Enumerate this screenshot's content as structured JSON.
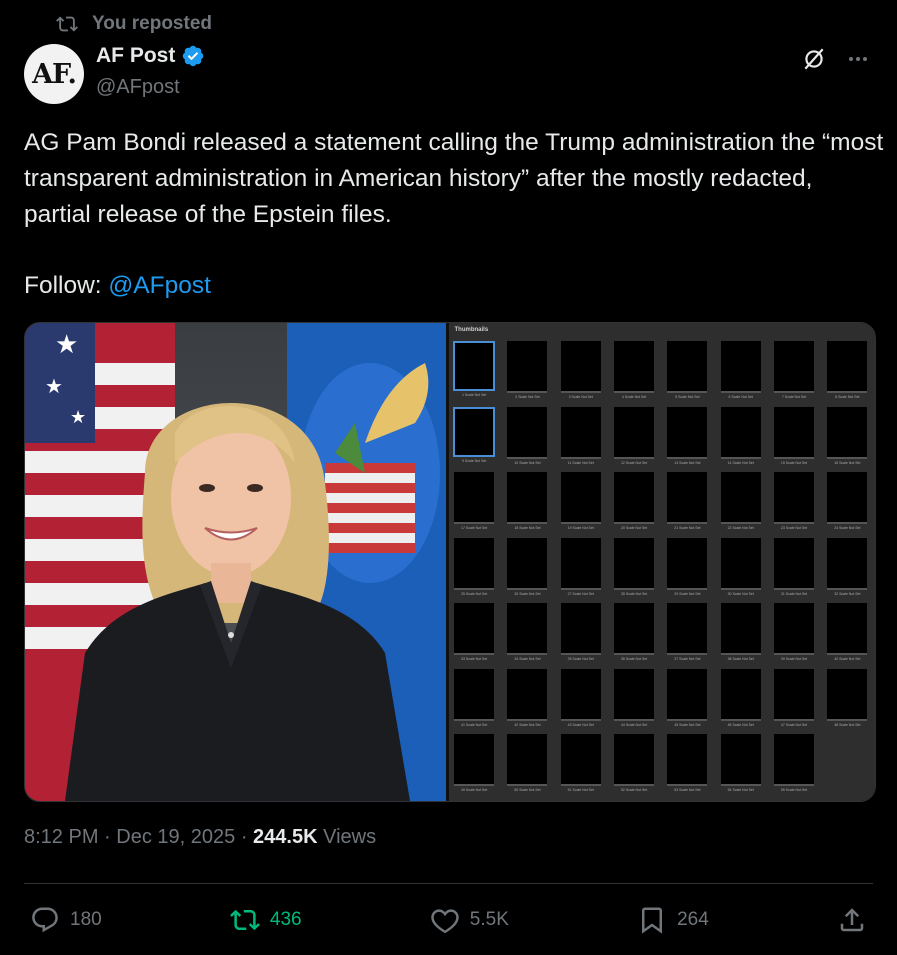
{
  "repost_notice": "You reposted",
  "author": {
    "avatar_text": "AF.",
    "name": "AF Post",
    "handle": "@AFpost",
    "verified": true
  },
  "tweet": {
    "text": "AG Pam Bondi released a statement calling the Trump administration the “most transparent administration in American history” after the mostly redacted, partial release of the Epstein files.",
    "follow_label": "Follow:",
    "follow_link": "@AFpost"
  },
  "media": {
    "thumbnails_header": "Thumbnails",
    "thumbnail_caption": "Scale Not Set",
    "thumbnail_count": 55
  },
  "meta": {
    "time": "8:12 PM",
    "date": "Dec 19, 2025",
    "views_count": "244.5K",
    "views_label": "Views"
  },
  "actions": {
    "replies": "180",
    "reposts": "436",
    "likes": "5.5K",
    "bookmarks": "264"
  },
  "colors": {
    "background": "#000000",
    "accent_blue": "#1d9bf0",
    "repost_green": "#00ba7c",
    "muted_text": "#71767b"
  }
}
